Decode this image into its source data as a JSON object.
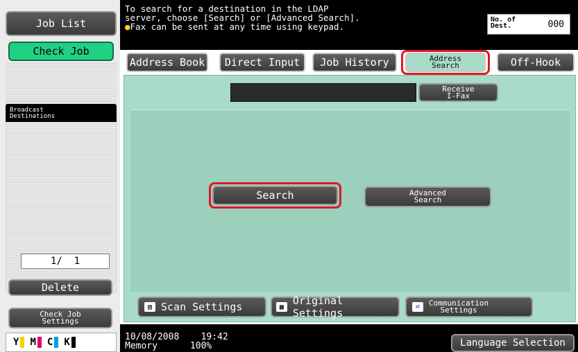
{
  "sidebar": {
    "job_list": "Job List",
    "check_job": "Check Job",
    "broadcast_title": "Broadcast\nDestinations",
    "page_indicator": "1/  1",
    "delete": "Delete",
    "check_job_settings": "Check Job\nSettings",
    "toner": {
      "y": "Y",
      "m": "M",
      "c": "C",
      "k": "K"
    }
  },
  "header": {
    "message_line1": "To search for a destination in the LDAP",
    "message_line2": "server, choose [Search] or [Advanced Search].",
    "message_line3": "Fax can be sent at any time using keypad.",
    "dest_label": "No. of\nDest.",
    "dest_value": "000"
  },
  "tabs": {
    "address_book": "Address Book",
    "direct_input": "Direct Input",
    "job_history": "Job History",
    "address_search": "Address\nSearch",
    "off_hook": "Off-Hook"
  },
  "main": {
    "receive_ifax": "Receive\nI-Fax",
    "search": "Search",
    "advanced_search": "Advanced\nSearch"
  },
  "bottom_buttons": {
    "scan_settings": "Scan Settings",
    "original_settings": "Original Settings",
    "communication_settings": "Communication\nSettings"
  },
  "status": {
    "date": "10/08/2008",
    "time": "19:42",
    "memory_label": "Memory",
    "memory_value": "100%",
    "language_selection": "Language Selection"
  },
  "colors": {
    "highlight": "#e01722",
    "panel": "#a8dbc8",
    "active_green": "#22d083"
  }
}
